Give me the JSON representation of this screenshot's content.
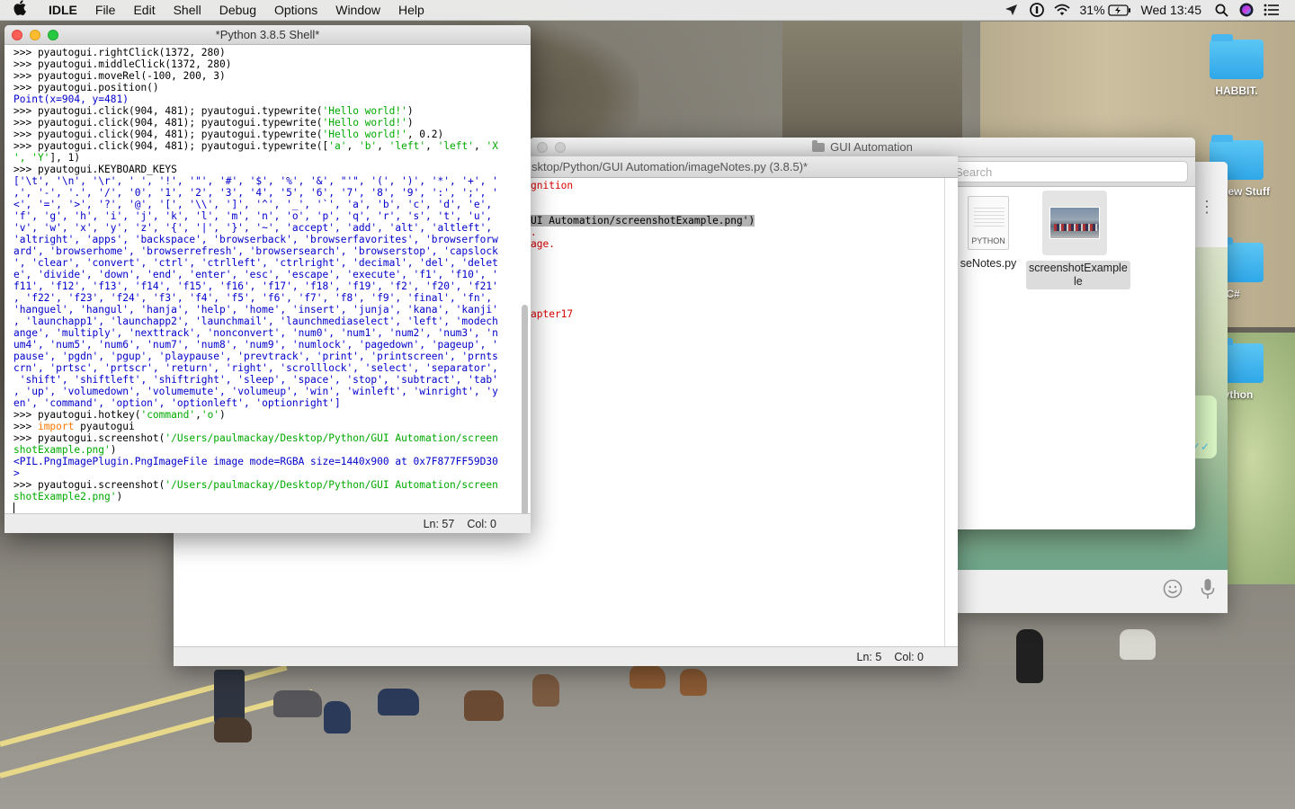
{
  "menubar": {
    "app": "IDLE",
    "items": [
      "File",
      "Edit",
      "Shell",
      "Debug",
      "Options",
      "Window",
      "Help"
    ],
    "battery": "31%",
    "datetime": "Wed 13:45",
    "icons": [
      "apple-icon",
      "send-icon",
      "onepassword-icon",
      "wifi-icon",
      "battery-icon",
      "spotlight-icon",
      "siri-icon",
      "notification-center-icon"
    ]
  },
  "desktop": {
    "folders": [
      "HABBIT.",
      "iew Stuff",
      "C#",
      "ython"
    ],
    "folder_color": "#2fa8e9"
  },
  "shell": {
    "title": "*Python 3.8.5 Shell*",
    "status_line": "Ln: 57",
    "status_col": "Col: 0",
    "lines": [
      [
        [
          "p",
          ">>> pyautogui.rightClick(1372, 280)"
        ]
      ],
      [
        [
          "p",
          ">>> pyautogui.middleClick(1372, 280)"
        ]
      ],
      [
        [
          "p",
          ">>> pyautogui.moveRel(-100, 200, 3)"
        ]
      ],
      [
        [
          "p",
          ">>> pyautogui.position()"
        ]
      ],
      [
        [
          "o",
          "Point(x=904, y=481)"
        ]
      ],
      [
        [
          "p",
          ">>> pyautogui.click(904, 481); pyautogui.typewrite("
        ],
        [
          "s",
          "'Hello world!'"
        ],
        [
          "p",
          ")"
        ]
      ],
      [
        [
          "p",
          ">>> pyautogui.click(904, 481); pyautogui.typewrite("
        ],
        [
          "s",
          "'Hello world!'"
        ],
        [
          "p",
          ")"
        ]
      ],
      [
        [
          "p",
          ">>> pyautogui.click(904, 481); pyautogui.typewrite("
        ],
        [
          "s",
          "'Hello world!'"
        ],
        [
          "p",
          ", 0.2)"
        ]
      ],
      [
        [
          "p",
          ">>> pyautogui.click(904, 481); pyautogui.typewrite(["
        ],
        [
          "s",
          "'a'"
        ],
        [
          "p",
          ", "
        ],
        [
          "s",
          "'b'"
        ],
        [
          "p",
          ", "
        ],
        [
          "s",
          "'left'"
        ],
        [
          "p",
          ", "
        ],
        [
          "s",
          "'left'"
        ],
        [
          "p",
          ", "
        ],
        [
          "s",
          "'X"
        ]
      ],
      [
        [
          "s",
          "', 'Y'"
        ],
        [
          "p",
          "], 1)"
        ]
      ],
      [
        [
          "p",
          ">>> pyautogui.KEYBOARD_KEYS"
        ]
      ],
      [
        [
          "o",
          "['\\t', '\\n', '\\r', ' ', '!', '\"', '#', '$', '%', '&', \"'\", '(', ')', '*', '+', '"
        ]
      ],
      [
        [
          "o",
          ",', '-', '.', '/', '0', '1', '2', '3', '4', '5', '6', '7', '8', '9', ':', ';', '"
        ]
      ],
      [
        [
          "o",
          "<', '=', '>', '?', '@', '[', '\\\\', ']', '^', '_', '`', 'a', 'b', 'c', 'd', 'e',"
        ]
      ],
      [
        [
          "o",
          "'f', 'g', 'h', 'i', 'j', 'k', 'l', 'm', 'n', 'o', 'p', 'q', 'r', 's', 't', 'u',"
        ]
      ],
      [
        [
          "o",
          "'v', 'w', 'x', 'y', 'z', '{', '|', '}', '~', 'accept', 'add', 'alt', 'altleft',"
        ]
      ],
      [
        [
          "o",
          "'altright', 'apps', 'backspace', 'browserback', 'browserfavorites', 'browserforw"
        ]
      ],
      [
        [
          "o",
          "ard', 'browserhome', 'browserrefresh', 'browsersearch', 'browserstop', 'capslock"
        ]
      ],
      [
        [
          "o",
          "', 'clear', 'convert', 'ctrl', 'ctrlleft', 'ctrlright', 'decimal', 'del', 'delet"
        ]
      ],
      [
        [
          "o",
          "e', 'divide', 'down', 'end', 'enter', 'esc', 'escape', 'execute', 'f1', 'f10', '"
        ]
      ],
      [
        [
          "o",
          "f11', 'f12', 'f13', 'f14', 'f15', 'f16', 'f17', 'f18', 'f19', 'f2', 'f20', 'f21'"
        ]
      ],
      [
        [
          "o",
          ", 'f22', 'f23', 'f24', 'f3', 'f4', 'f5', 'f6', 'f7', 'f8', 'f9', 'final', 'fn',"
        ]
      ],
      [
        [
          "o",
          "'hanguel', 'hangul', 'hanja', 'help', 'home', 'insert', 'junja', 'kana', 'kanji'"
        ]
      ],
      [
        [
          "o",
          ", 'launchapp1', 'launchapp2', 'launchmail', 'launchmediaselect', 'left', 'modech"
        ]
      ],
      [
        [
          "o",
          "ange', 'multiply', 'nexttrack', 'nonconvert', 'num0', 'num1', 'num2', 'num3', 'n"
        ]
      ],
      [
        [
          "o",
          "um4', 'num5', 'num6', 'num7', 'num8', 'num9', 'numlock', 'pagedown', 'pageup', '"
        ]
      ],
      [
        [
          "o",
          "pause', 'pgdn', 'pgup', 'playpause', 'prevtrack', 'print', 'printscreen', 'prnts"
        ]
      ],
      [
        [
          "o",
          "crn', 'prtsc', 'prtscr', 'return', 'right', 'scrolllock', 'select', 'separator',"
        ]
      ],
      [
        [
          "o",
          " 'shift', 'shiftleft', 'shiftright', 'sleep', 'space', 'stop', 'subtract', 'tab'"
        ]
      ],
      [
        [
          "o",
          ", 'up', 'volumedown', 'volumemute', 'volumeup', 'win', 'winleft', 'winright', 'y"
        ]
      ],
      [
        [
          "o",
          "en', 'command', 'option', 'optionleft', 'optionright']"
        ]
      ],
      [
        [
          "p",
          ">>> pyautogui.hotkey("
        ],
        [
          "s",
          "'command'"
        ],
        [
          "p",
          ","
        ],
        [
          "s",
          "'o'"
        ],
        [
          "p",
          ")"
        ]
      ],
      [
        [
          "p",
          ">>> "
        ],
        [
          "k",
          "import"
        ],
        [
          "p",
          " pyautogui"
        ]
      ],
      [
        [
          "p",
          ">>> pyautogui.screenshot("
        ],
        [
          "s",
          "'/Users/paulmackay/Desktop/Python/GUI Automation/screen"
        ]
      ],
      [
        [
          "s",
          "shotExample.png'"
        ],
        [
          "p",
          ")"
        ]
      ],
      [
        [
          "o",
          "<PIL.PngImagePlugin.PngImageFile image mode=RGBA size=1440x900 at 0x7F877FF59D30"
        ]
      ],
      [
        [
          "o",
          ">"
        ]
      ],
      [
        [
          "p",
          ">>> pyautogui.screenshot("
        ],
        [
          "s",
          "'/Users/paulmackay/Desktop/Python/GUI Automation/screen"
        ]
      ],
      [
        [
          "s",
          "shotExample2.png'"
        ],
        [
          "p",
          ")"
        ]
      ],
      [
        [
          "p",
          ""
        ]
      ]
    ]
  },
  "editor": {
    "title": "sktop/Python/GUI Automation/imageNotes.py (3.8.5)*",
    "status_line": "Ln: 5",
    "status_col": "Col: 0",
    "lines": [
      [
        [
          "r",
          "gnition"
        ]
      ],
      [
        [
          "p",
          ""
        ]
      ],
      [
        [
          "p",
          ""
        ]
      ],
      [
        [
          "sel",
          "UI Automation/screenshotExample.png')"
        ]
      ],
      [
        [
          "r",
          "."
        ]
      ],
      [
        [
          "r",
          "age."
        ]
      ],
      [
        [
          "p",
          ""
        ]
      ],
      [
        [
          "p",
          ""
        ]
      ],
      [
        [
          "p",
          ""
        ]
      ],
      [
        [
          "p",
          ""
        ]
      ],
      [
        [
          "p",
          ""
        ]
      ],
      [
        [
          "r",
          "apter17"
        ]
      ]
    ]
  },
  "finder": {
    "title": "GUI Automation",
    "search_placeholder": "Search",
    "files": [
      {
        "name": "seNotes.py",
        "badge": "PYTHON"
      },
      {
        "name": "screenshotExample",
        "name2": "le"
      }
    ]
  },
  "chat": {
    "kebab": "⋮",
    "ticks": "✓✓"
  }
}
